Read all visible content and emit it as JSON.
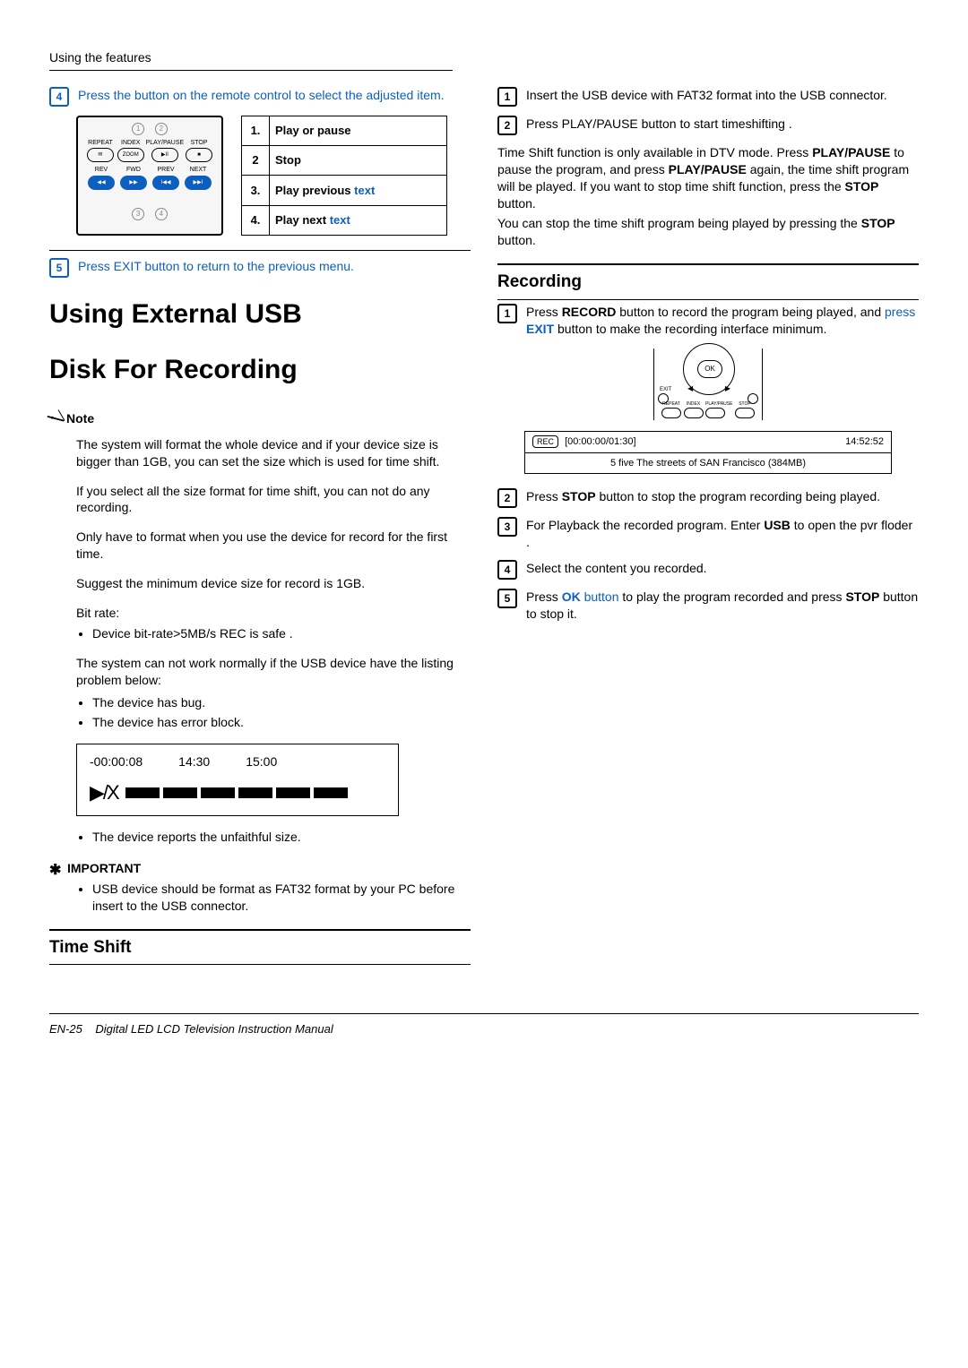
{
  "header": {
    "breadcrumb": "Using the features"
  },
  "left": {
    "step4": "Press the button on the remote control to select the adjusted item.",
    "remote": {
      "row1": [
        "REPEAT",
        "INDEX",
        "PLAY/PAUSE",
        "STOP"
      ],
      "row1b": [
        "✉",
        "ZOOM",
        "▶II",
        "■"
      ],
      "row2": [
        "REV",
        "FWD",
        "PREV",
        "NEXT"
      ],
      "row2b": [
        "◀◀",
        "▶▶",
        "I◀◀",
        "▶▶I"
      ],
      "circles_top": [
        "1",
        "2"
      ],
      "circles_bottom": [
        "3",
        "4"
      ]
    },
    "legend": [
      {
        "n": "1.",
        "label": "Play or pause"
      },
      {
        "n": "2",
        "label": "Stop"
      },
      {
        "n": "3.",
        "label": "Play previous ",
        "extra": "text"
      },
      {
        "n": "4.",
        "label": "Play next ",
        "extra": "text"
      }
    ],
    "step5": "Press EXIT button to return to the previous menu.",
    "main_heading_1": "Using External USB",
    "main_heading_2": "Disk For Recording",
    "note_label": "Note",
    "note_paragraphs": [
      "The system will format the whole device and if your device size is bigger than 1GB, you can set the size which is used for time shift.",
      "If you select all the size format for time shift, you can not do any recording.",
      "Only have to format when you use the device for record for the first time.",
      "Suggest the minimum device size for record is 1GB.",
      "Bit rate:"
    ],
    "bullet1": "Device bit-rate>5MB/s REC is safe .",
    "after_bitrate": "The system can not work normally if the USB device have the listing problem below:",
    "bullets2": [
      "The device has bug.",
      "The device has error block."
    ],
    "playback": {
      "t1": "-00:00:08",
      "t2": "14:30",
      "t3": "15:00",
      "sym": "▶/X"
    },
    "bullet3": "The device reports the unfaithful size.",
    "important_label": "IMPORTANT",
    "important_text": "USB device should be format as FAT32 format by your PC before insert to the USB connector.",
    "timeshift_heading": "Time Shift"
  },
  "right": {
    "ts_step1": "Insert the USB device with FAT32 format into the USB connector.",
    "ts_step2": "Press PLAY/PAUSE button to start timeshifting .",
    "ts_para1a": "Time Shift function is only available in DTV mode. Press ",
    "ts_para1b": "PLAY/PAUSE",
    "ts_para1c": " to pause the program, and press ",
    "ts_para1d": "PLAY/PAUSE",
    "ts_para1e": " again, the time shift program will be played. If you want to stop time shift function, press the ",
    "ts_para1f": "STOP",
    "ts_para1g": " button.",
    "ts_para2a": "You can stop the time shift program being played by pressing the ",
    "ts_para2b": "STOP",
    "ts_para2c": " button.",
    "rec_heading": "Recording",
    "rec_step1a": "Press ",
    "rec_step1b": "RECORD",
    "rec_step1c": " button to record the program being played, and ",
    "rec_step1d": "press ",
    "rec_step1e": "EXIT",
    "rec_step1f": " button to make the recording interface minimum.",
    "ok_labels": {
      "center": "OK",
      "row": [
        "REPEAT",
        "INDEX",
        "PLAY/PAUSE",
        "STOP"
      ]
    },
    "rec_box": {
      "badge": "REC",
      "time_range": "[00:00:00/01:30]",
      "clock": "14:52:52",
      "title": "5 five The streets of SAN Francisco (384MB)"
    },
    "rec_step2a": "Press ",
    "rec_step2b": "STOP",
    "rec_step2c": " button to stop the program recording being played.",
    "rec_step3a": "For Playback the recorded program. Enter ",
    "rec_step3b": "USB",
    "rec_step3c": " to open the pvr floder .",
    "rec_step4": "Select the content you recorded.",
    "rec_step5a": "Press ",
    "rec_step5b": "OK",
    "rec_step5c": " button",
    "rec_step5d": " to play the program recorded and press ",
    "rec_step5e": "STOP",
    "rec_step5f": " button to stop it."
  },
  "footer": {
    "page": "EN-25",
    "title": "Digital LED LCD Television Instruction Manual"
  }
}
